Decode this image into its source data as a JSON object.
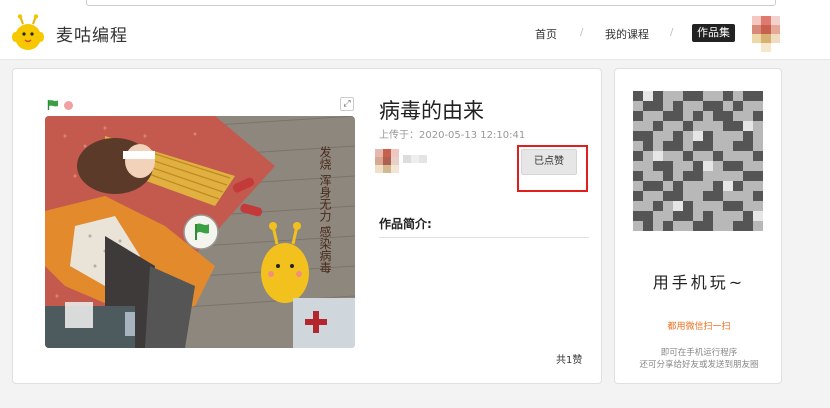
{
  "header": {
    "brand": "麦咕编程",
    "nav": {
      "home": "首页",
      "my_courses": "我的课程",
      "works": "作品集"
    },
    "nav_separator": "/"
  },
  "work": {
    "title": "病毒的由来",
    "upload_time": "上传于：2020-05-13 12:10:41",
    "like_button": "已点赞",
    "intro_label": "作品简介:",
    "likes_total": "共1赞",
    "stage_text": "发烧 浑身无力 感染病毒"
  },
  "sidebar": {
    "phone_play": "用手机玩~",
    "scan_hint": "都用微信扫一扫",
    "desc_line1": "即可在手机运行程序",
    "desc_line2": "还可分享给好友或发送到朋友圈"
  },
  "colors": {
    "accent_red": "#e21d1d",
    "scan_orange": "#f07020",
    "run_green": "#3aa043"
  },
  "icons": [
    "mascot-logo-icon",
    "green-flag-icon",
    "stop-icon",
    "fullscreen-icon",
    "play-flag-icon"
  ]
}
